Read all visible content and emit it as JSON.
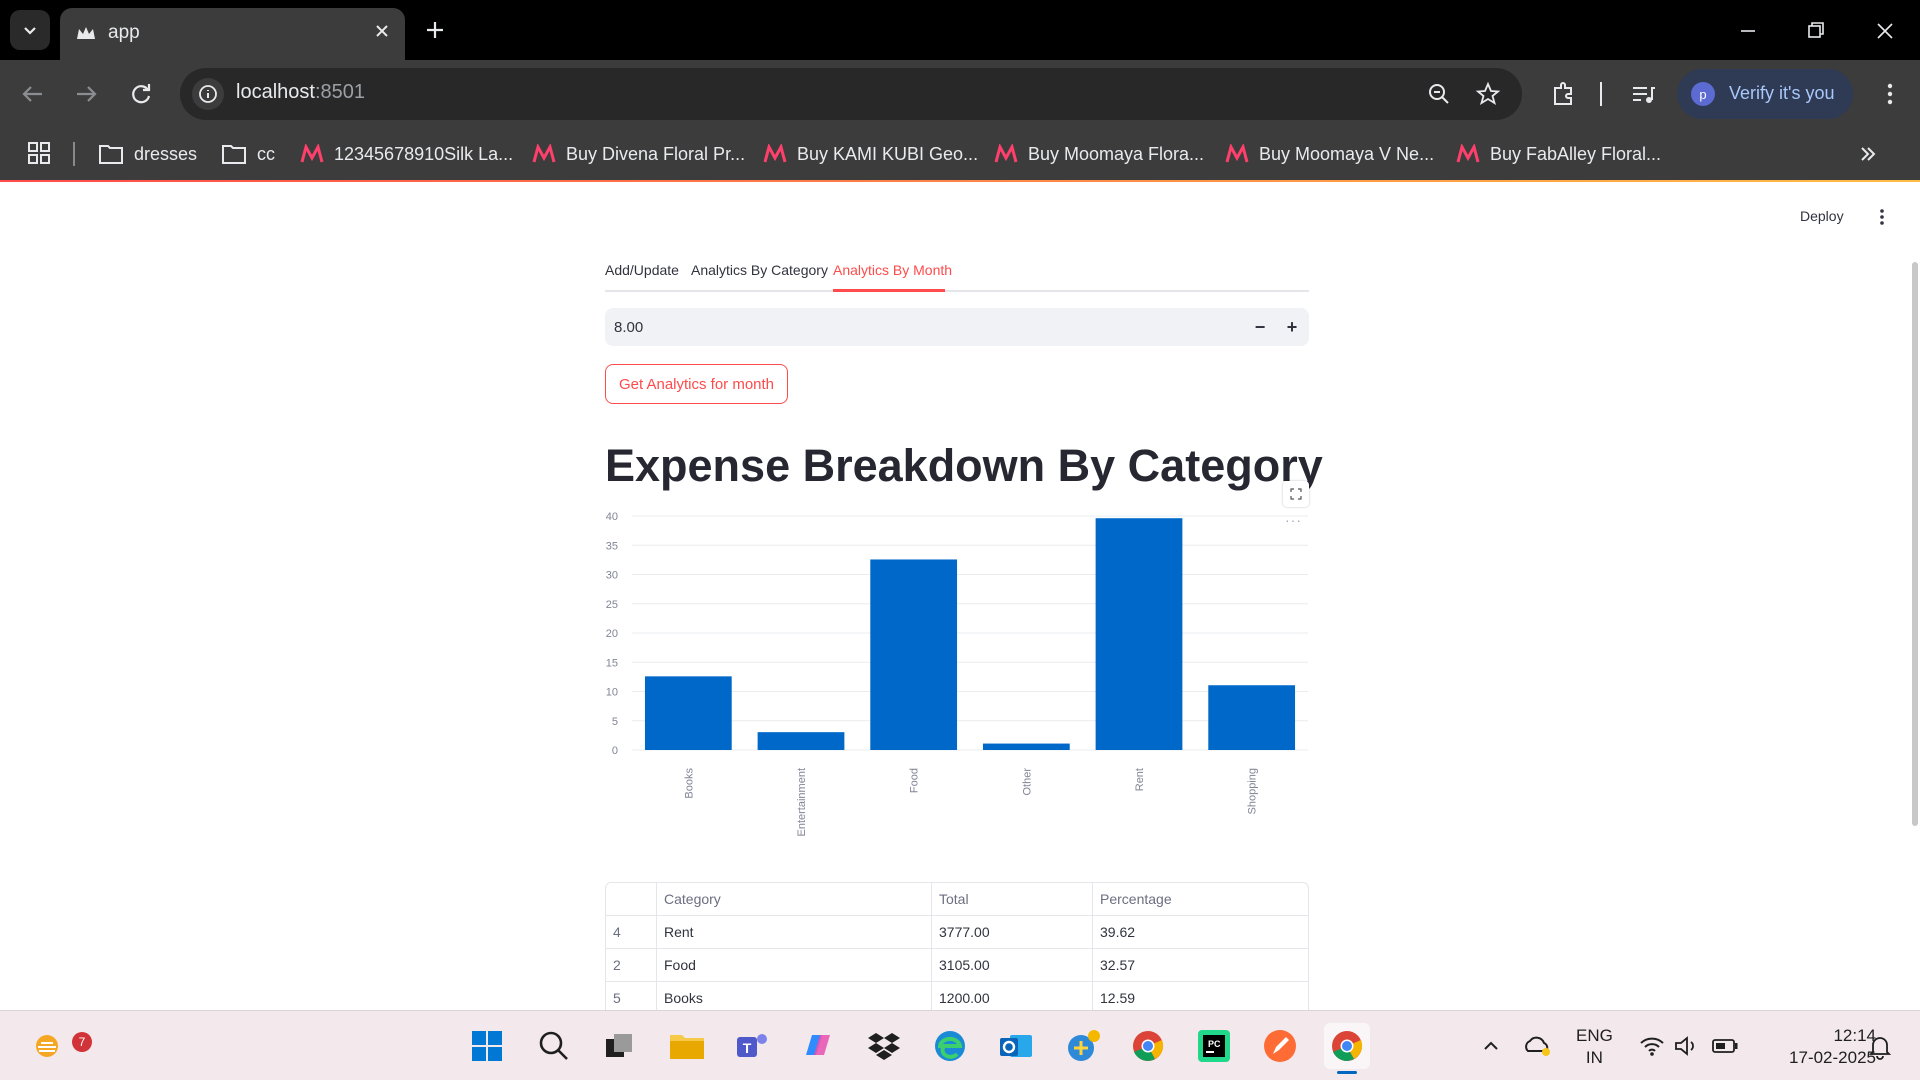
{
  "browser": {
    "tab_title": "app",
    "url_host": "localhost",
    "url_port": ":8501",
    "verify_label": "Verify it's you",
    "profile_initial": "p",
    "bookmarks": [
      {
        "label": "dresses",
        "icon": "folder-icon"
      },
      {
        "label": "cc",
        "icon": "folder-icon"
      },
      {
        "label": "12345678910Silk La...",
        "icon": "myntra-icon"
      },
      {
        "label": "Buy Divena Floral Pr...",
        "icon": "myntra-icon"
      },
      {
        "label": "Buy KAMI KUBI Geo...",
        "icon": "myntra-icon"
      },
      {
        "label": "Buy Moomaya Flora...",
        "icon": "myntra-icon"
      },
      {
        "label": "Buy Moomaya V Ne...",
        "icon": "myntra-icon"
      },
      {
        "label": "Buy FabAlley Floral...",
        "icon": "myntra-icon"
      }
    ]
  },
  "app": {
    "deploy_label": "Deploy",
    "tabs": [
      {
        "label": "Add/Update",
        "active": false
      },
      {
        "label": "Analytics By Category",
        "active": false
      },
      {
        "label": "Analytics By Month",
        "active": true
      }
    ],
    "month_input": "8.00",
    "step_minus": "−",
    "step_plus": "+",
    "get_button": "Get Analytics for month",
    "heading": "Expense Breakdown By Category",
    "chart_more": "···"
  },
  "chart_data": {
    "type": "bar",
    "categories": [
      "Books",
      "Entertainment",
      "Food",
      "Other",
      "Rent",
      "Shopping"
    ],
    "values": [
      12.59,
      3.05,
      32.57,
      1.1,
      39.62,
      11.07
    ],
    "title": "",
    "xlabel": "",
    "ylabel": "",
    "ylim": [
      0,
      40
    ],
    "yticks": [
      0,
      5,
      10,
      15,
      20,
      25,
      30,
      35,
      40
    ],
    "bar_color": "#0068c9",
    "grid": true
  },
  "table": {
    "columns": [
      "",
      "Category",
      "Total",
      "Percentage"
    ],
    "rows": [
      [
        "4",
        "Rent",
        "3777.00",
        "39.62"
      ],
      [
        "2",
        "Food",
        "3105.00",
        "32.57"
      ],
      [
        "5",
        "Books",
        "1200.00",
        "12.59"
      ]
    ]
  },
  "taskbar": {
    "weather_badge": "7",
    "lang_line1": "ENG",
    "lang_line2": "IN",
    "time": "12:14",
    "date": "17-02-2025"
  },
  "colors": {
    "accent": "#ff4b4b",
    "bar": "#0068c9",
    "chrome_dark": "#3c3c3c"
  }
}
